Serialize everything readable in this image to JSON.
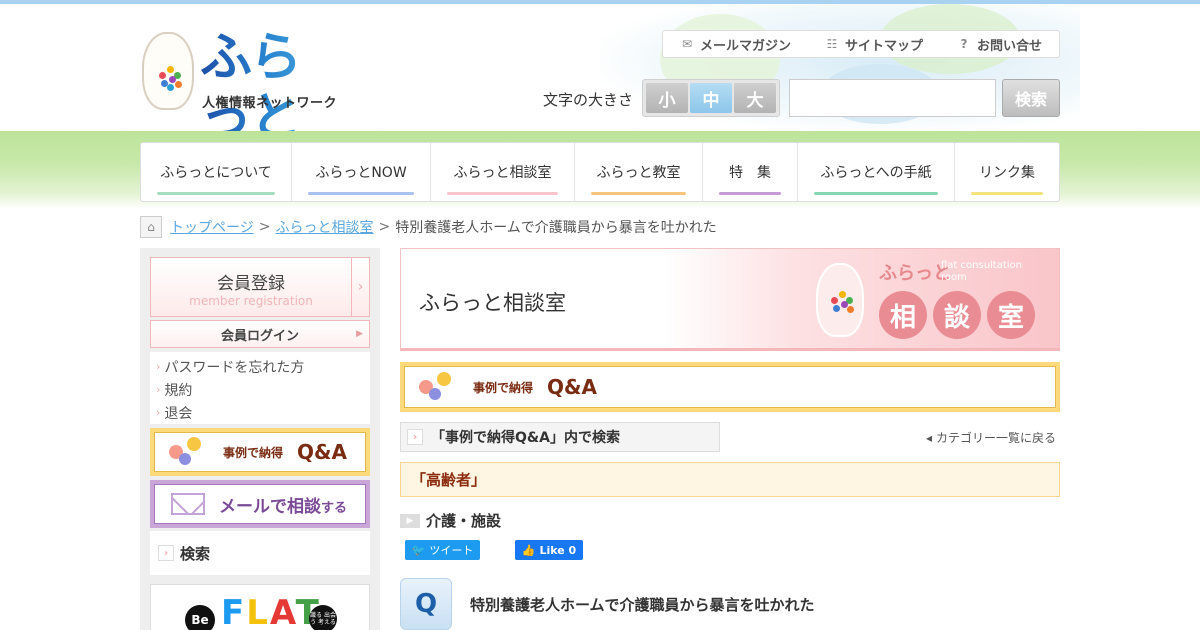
{
  "header": {
    "logo_text": "ふらっと",
    "logo_sub": "人権情報ネットワーク",
    "utility": [
      {
        "label": "メールマガジン",
        "icon": "mail-icon"
      },
      {
        "label": "サイトマップ",
        "icon": "sitemap-icon"
      },
      {
        "label": "お問い合せ",
        "icon": "question-icon"
      }
    ],
    "font_size_label": "文字の大きさ",
    "font_sizes": [
      "小",
      "中",
      "大"
    ],
    "font_size_selected": "中",
    "search_placeholder": "",
    "search_button": "検索"
  },
  "nav": [
    {
      "label": "ふらっとについて",
      "color": "#a6dcc0"
    },
    {
      "label": "ふらっとNOW",
      "color": "#a9c3ee"
    },
    {
      "label": "ふらっと相談室",
      "color": "#f7c6cc"
    },
    {
      "label": "ふらっと教室",
      "color": "#f9c57d"
    },
    {
      "label": "特　集",
      "color": "#c69ad6"
    },
    {
      "label": "ふらっとへの手紙",
      "color": "#86d8b5"
    },
    {
      "label": "リンク集",
      "color": "#f4e27c"
    }
  ],
  "breadcrumb": {
    "home": "トップページ",
    "section": "ふらっと相談室",
    "current": "特別養護老人ホームで介護職員から暴言を吐かれた"
  },
  "sidebar": {
    "register_title": "会員登録",
    "register_sub": "member registration",
    "login": "会員ログイン",
    "links": [
      "パスワードを忘れた方",
      "規約",
      "退会"
    ],
    "qa_small": "事例で納得",
    "qa_big": "Q&A",
    "mail_text": "メールで相談",
    "mail_suffix": "する",
    "search": "検索",
    "beflat_be": "Be",
    "beflat_text": "FLAT",
    "beflat_small": "識る 出会う 考える"
  },
  "main": {
    "hero_title": "ふらっと相談室",
    "hero_small": "ふらっと",
    "hero_en": "flat consultation room",
    "hero_chars": [
      "相",
      "談",
      "室"
    ],
    "qa_small": "事例で納得",
    "qa_big": "Q&A",
    "category_search": "「事例で納得Q&A」内で検索",
    "back_link": "カテゴリー一覧に戻る",
    "category": "「高齢者」",
    "subcategory": "介護・施設",
    "tweet": "ツイート",
    "like": "Like 0",
    "q_label": "Q",
    "question": "特別養護老人ホームで介護職員から暴言を吐かれた"
  },
  "colors": {
    "accent_pink": "#e98c93",
    "accent_yellow": "#fcd97b",
    "accent_green": "#bde49a"
  }
}
